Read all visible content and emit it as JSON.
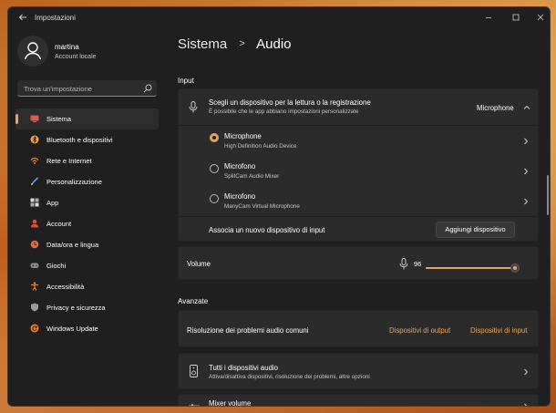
{
  "window": {
    "title": "Impostazioni"
  },
  "profile": {
    "name": "martina",
    "subtitle": "Account locale"
  },
  "search": {
    "placeholder": "Trova un'impostazione"
  },
  "sidebar": {
    "items": [
      {
        "label": "Sistema",
        "icon": "monitor-icon",
        "color": "#e05b4f",
        "active": true
      },
      {
        "label": "Bluetooth e dispositivi",
        "icon": "bluetooth-icon",
        "color": "#f0a040"
      },
      {
        "label": "Rete e Internet",
        "icon": "wifi-icon",
        "color": "#f07a3a"
      },
      {
        "label": "Personalizzazione",
        "icon": "brush-icon",
        "color": "#5aa0e8"
      },
      {
        "label": "App",
        "icon": "apps-icon",
        "color": "#d8d8d8"
      },
      {
        "label": "Account",
        "icon": "person-icon",
        "color": "#e84a3a"
      },
      {
        "label": "Data/ora e lingua",
        "icon": "globe-clock-icon",
        "color": "#e06a3a"
      },
      {
        "label": "Giochi",
        "icon": "gamepad-icon",
        "color": "#8a8a8a"
      },
      {
        "label": "Accessibilità",
        "icon": "accessibility-icon",
        "color": "#f08a3a"
      },
      {
        "label": "Privacy e sicurezza",
        "icon": "shield-icon",
        "color": "#9a9a9a"
      },
      {
        "label": "Windows Update",
        "icon": "update-icon",
        "color": "#f07a2a"
      }
    ]
  },
  "breadcrumb": {
    "parent": "Sistema",
    "separator": ">",
    "current": "Audio"
  },
  "input": {
    "section_title": "Input",
    "header": {
      "title": "Scegli un dispositivo per la lettura o la registrazione",
      "subtitle": "È possibile che le app abbiano impostazioni personalizzate",
      "selected": "Microphone"
    },
    "devices": [
      {
        "name": "Microphone",
        "sub": "High Definition Audio Device",
        "checked": true
      },
      {
        "name": "Microfono",
        "sub": "SplitCam Audio Mixer",
        "checked": false
      },
      {
        "name": "Microfono",
        "sub": "ManyCam Virtual Microphone",
        "checked": false
      }
    ],
    "pair": {
      "label": "Associa un nuovo dispositivo di input",
      "button": "Aggiungi dispositivo"
    },
    "volume": {
      "label": "Volume",
      "value": "96",
      "level": 0.96
    }
  },
  "advanced": {
    "section_title": "Avanzate",
    "troubleshoot": {
      "label": "Risoluzione dei problemi audio comuni",
      "output_link": "Dispositivi di output",
      "input_link": "Dispositivi di input"
    },
    "all_devices": {
      "title": "Tutti i dispositivi audio",
      "subtitle": "Attiva/disattiva dispositivi, risoluzione dei problemi, altre opzioni"
    },
    "mixer": {
      "title": "Mixer volume"
    }
  },
  "colors": {
    "accent": "#e8a45e",
    "window_bg": "#1f1f1f",
    "card_bg": "#2b2b2b"
  }
}
